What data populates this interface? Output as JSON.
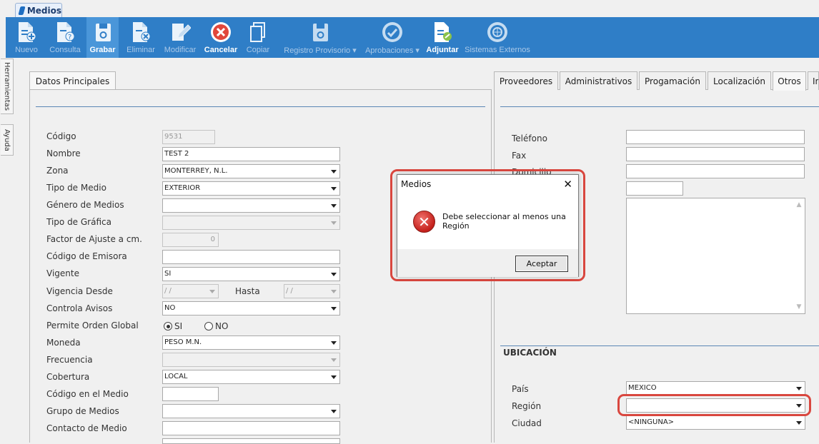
{
  "app_tab": {
    "label": "Medios"
  },
  "toolbar": [
    {
      "label": "Nuevo",
      "icon": "new-doc-icon",
      "state": "disabled"
    },
    {
      "label": "Consulta",
      "icon": "query-doc-icon",
      "state": "disabled"
    },
    {
      "label": "Grabar",
      "icon": "save-icon",
      "state": "active"
    },
    {
      "label": "Eliminar",
      "icon": "delete-doc-icon",
      "state": "disabled"
    },
    {
      "label": "Modificar",
      "icon": "edit-doc-icon",
      "state": "disabled"
    },
    {
      "label": "Cancelar",
      "icon": "cancel-icon",
      "state": "enabled"
    },
    {
      "label": "Copiar",
      "icon": "copy-icon",
      "state": "disabled"
    },
    {
      "label": "Registro Provisorio ▾",
      "icon": "provisional-save-icon",
      "state": "disabled"
    },
    {
      "label": "Aprobaciones ▾",
      "icon": "approvals-icon",
      "state": "disabled"
    },
    {
      "label": "Adjuntar",
      "icon": "attach-icon",
      "state": "enabled"
    },
    {
      "label": "Sistemas Externos",
      "icon": "external-systems-icon",
      "state": "disabled"
    }
  ],
  "side_tabs": [
    "Herramientas",
    "Ayuda"
  ],
  "left_panel": {
    "tab": "Datos Principales",
    "fields": {
      "codigo": {
        "label": "Código",
        "value": "9531"
      },
      "nombre": {
        "label": "Nombre",
        "value": "TEST 2"
      },
      "zona": {
        "label": "Zona",
        "value": "MONTERREY, N.L."
      },
      "tipo_medio": {
        "label": "Tipo de Medio",
        "value": "EXTERIOR"
      },
      "genero": {
        "label": "Género de Medios",
        "value": ""
      },
      "tipo_grafica": {
        "label": "Tipo de Gráfica",
        "value": ""
      },
      "factor": {
        "label": "Factor de Ajuste a cm.",
        "value": "0"
      },
      "emisora": {
        "label": "Código de Emisora",
        "value": ""
      },
      "vigente": {
        "label": "Vigente",
        "value": "SI"
      },
      "vig_desde": {
        "label": "Vigencia Desde",
        "value": " /  /"
      },
      "hasta": {
        "label": "Hasta",
        "value": " /  /"
      },
      "avisos": {
        "label": "Controla Avisos",
        "value": "NO"
      },
      "orden_global": {
        "label": "Permite Orden Global",
        "opt_si": "SI",
        "opt_no": "NO"
      },
      "moneda": {
        "label": "Moneda",
        "value": "PESO M.N."
      },
      "frecuencia": {
        "label": "Frecuencia",
        "value": ""
      },
      "cobertura": {
        "label": "Cobertura",
        "value": "LOCAL"
      },
      "cod_medio": {
        "label": "Código en el Medio",
        "value": ""
      },
      "grupo": {
        "label": "Grupo de Medios",
        "value": ""
      },
      "contacto": {
        "label": "Contacto de Medio",
        "value": ""
      }
    }
  },
  "right_panel": {
    "tabs": [
      "Proveedores",
      "Administrativos",
      "Progamación",
      "Localización",
      "Otros",
      "In"
    ],
    "selected_tab": "Otros",
    "fields": {
      "telefono": {
        "label": "Teléfono",
        "value": ""
      },
      "fax": {
        "label": "Fax",
        "value": ""
      },
      "domicilio": {
        "label": "Domicilio",
        "value": ""
      }
    },
    "section": "UBICACIÓN",
    "ubicacion": {
      "pais": {
        "label": "País",
        "value": "MEXICO"
      },
      "region": {
        "label": "Región",
        "value": ""
      },
      "ciudad": {
        "label": "Ciudad",
        "value": "<NINGUNA>"
      }
    }
  },
  "dialog": {
    "title": "Medios",
    "message": "Debe seleccionar al menos una Región",
    "button": "Aceptar"
  },
  "colors": {
    "toolbar": "#2f7ec7",
    "highlight": "#d9473f"
  }
}
